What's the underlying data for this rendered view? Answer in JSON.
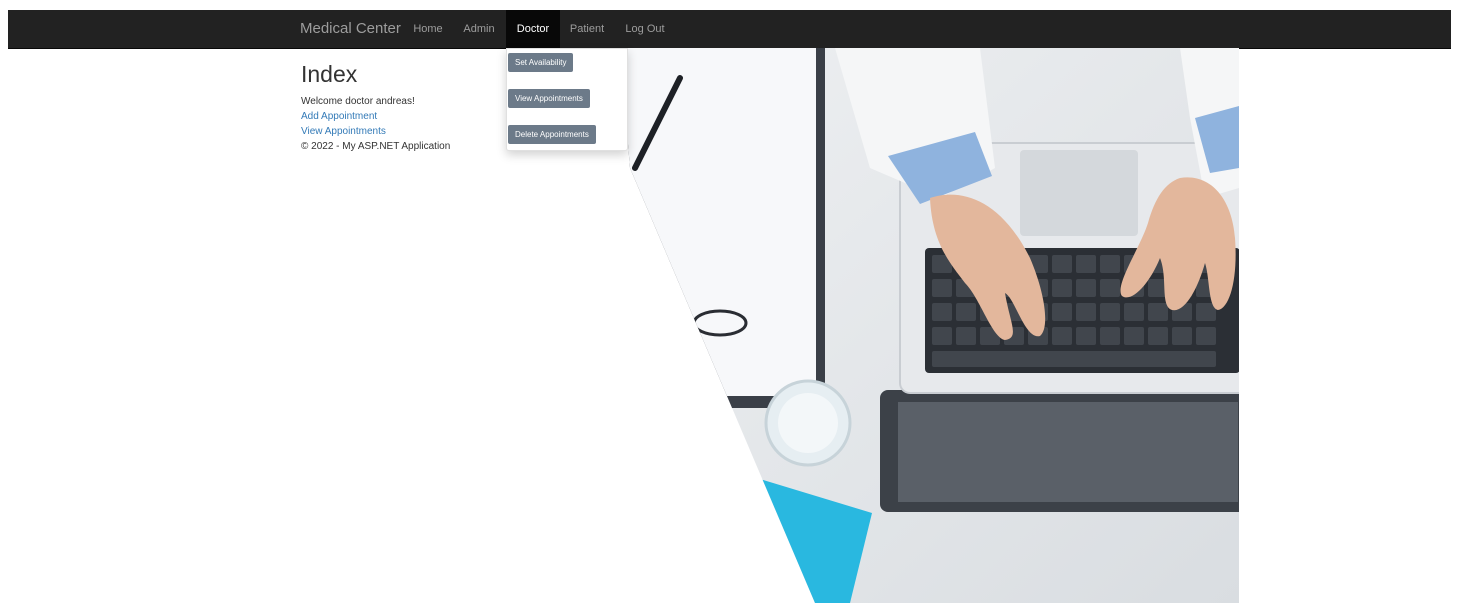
{
  "navbar": {
    "brand": "Medical Center",
    "items": [
      {
        "label": "Home"
      },
      {
        "label": "Admin"
      },
      {
        "label": "Doctor"
      },
      {
        "label": "Patient"
      },
      {
        "label": "Log Out"
      }
    ]
  },
  "doctor_menu": {
    "items": [
      {
        "label": "Set Availability"
      },
      {
        "label": "View Appointments"
      },
      {
        "label": "Delete Appointments"
      }
    ]
  },
  "main": {
    "title": "Index",
    "welcome": "Welcome doctor andreas!",
    "links": [
      {
        "label": "Add Appointment"
      },
      {
        "label": "View Appointments"
      }
    ],
    "footer": "© 2022 - My ASP.NET Application"
  },
  "colors": {
    "navbar_bg": "#222222",
    "link": "#337ab7",
    "menu_button": "#6c7a89",
    "accent_blue": "#29b8e0"
  }
}
